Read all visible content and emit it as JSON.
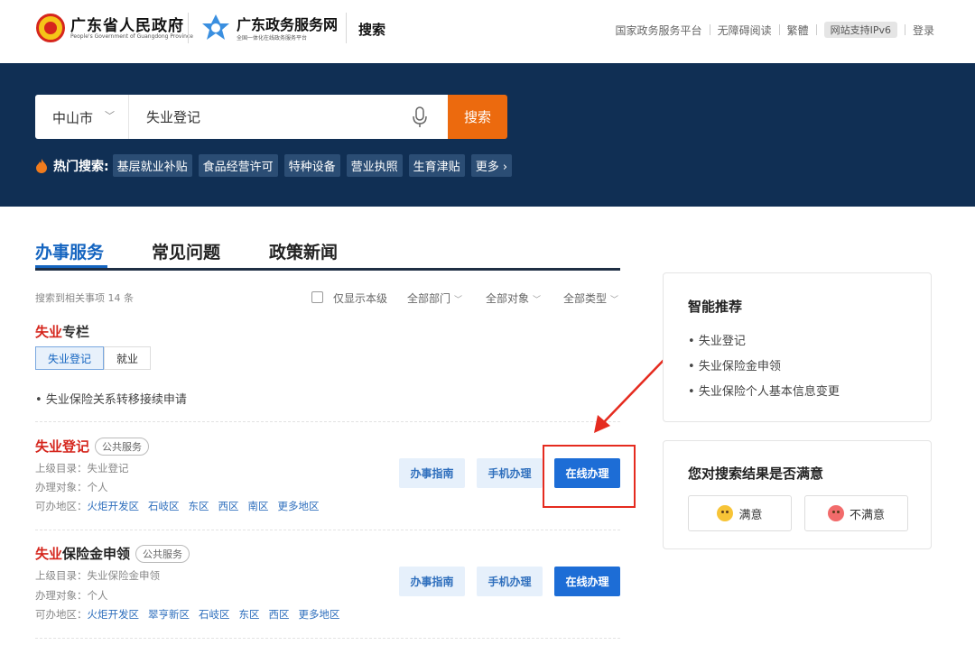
{
  "header": {
    "gov_title": "广东省人民政府",
    "gov_subtitle": "People's Government of Guangdong Province",
    "portal_title": "广东政务服务网",
    "portal_subtitle": "全国一体化在线政务服务平台",
    "section_title": "搜索",
    "links": [
      "国家政务服务平台",
      "无障碍阅读",
      "繁體",
      "网站支持IPv6",
      "登录"
    ]
  },
  "search": {
    "city": "中山市",
    "query": "失业登记",
    "button": "搜索",
    "hot_label": "热门搜索:",
    "hot_tags": [
      "基层就业补贴",
      "食品经营许可",
      "特种设备",
      "营业执照",
      "生育津贴",
      "更多 ›"
    ]
  },
  "tabs": [
    "办事服务",
    "常见问题",
    "政策新闻"
  ],
  "results": {
    "count_text": "搜索到相关事项 14 条",
    "only_local": "仅显示本级",
    "filters": [
      "全部部门",
      "全部对象",
      "全部类型"
    ]
  },
  "column": {
    "title_highlight": "失业",
    "title_rest": "专栏",
    "subtabs": [
      "失业登记",
      "就业"
    ],
    "items": [
      "失业保险关系转移接续申请"
    ]
  },
  "services": [
    {
      "title_highlight": "失业登记",
      "title_rest": "",
      "tag": "公共服务",
      "catalog": "上级目录：失业登记",
      "target": "办理对象：个人",
      "regions_label": "可办地区：",
      "regions": [
        "火炬开发区",
        "石岐区",
        "东区",
        "西区",
        "南区",
        "更多地区"
      ],
      "buttons": [
        "办事指南",
        "手机办理",
        "在线办理"
      ]
    },
    {
      "title_highlight": "失业",
      "title_rest": "保险金申领",
      "tag": "公共服务",
      "catalog": "上级目录：失业保险金申领",
      "target": "办理对象：个人",
      "regions_label": "可办地区：",
      "regions": [
        "火炬开发区",
        "翠亨新区",
        "石岐区",
        "东区",
        "西区",
        "更多地区"
      ],
      "buttons": [
        "办事指南",
        "手机办理",
        "在线办理"
      ]
    }
  ],
  "recommend": {
    "title": "智能推荐",
    "items": [
      "失业登记",
      "失业保险金申领",
      "失业保险个人基本信息变更"
    ]
  },
  "feedback": {
    "title": "您对搜索结果是否满意",
    "satisfied": "满意",
    "unsatisfied": "不满意"
  },
  "colors": {
    "accent": "#1d6dd6",
    "hero_bg": "#102f54",
    "search_btn": "#ec6a0e",
    "highlight": "#d5261d",
    "annotation": "#e52b1f"
  }
}
